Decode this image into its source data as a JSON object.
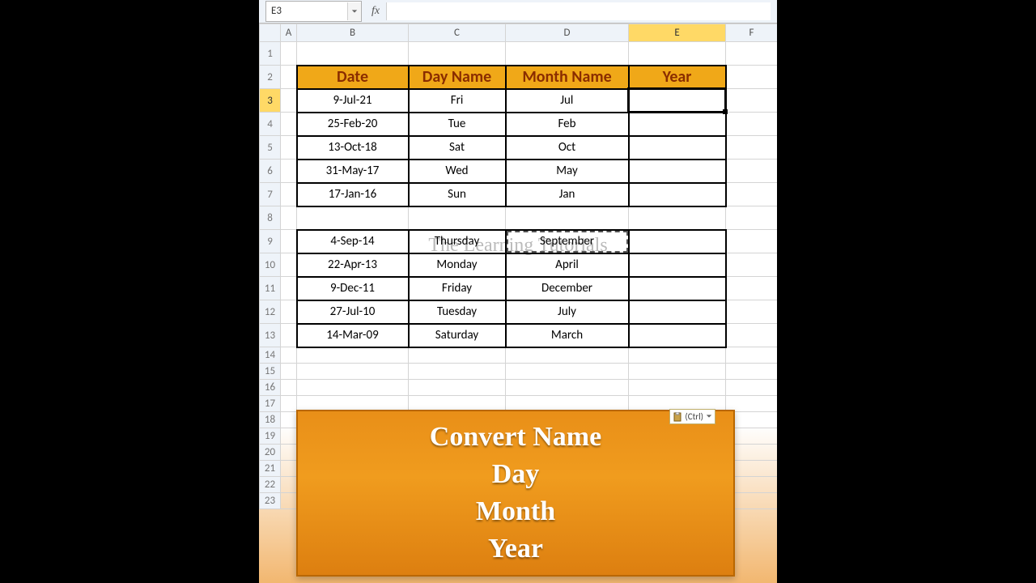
{
  "namebox": {
    "value": "E3"
  },
  "formula_bar": {
    "fx_label": "fx",
    "value": ""
  },
  "columns": [
    "A",
    "B",
    "C",
    "D",
    "E",
    "F"
  ],
  "active": {
    "col": "E",
    "row": 3
  },
  "marquee_cell": "D9",
  "rows_visible": [
    1,
    2,
    3,
    4,
    5,
    6,
    7,
    8,
    9,
    10,
    11,
    12,
    13,
    14,
    15,
    16,
    17,
    18,
    19,
    20,
    21,
    22,
    23
  ],
  "table1": {
    "header_row": 2,
    "headers": [
      "Date",
      "Day Name",
      "Month Name",
      "Year"
    ],
    "rows": [
      {
        "r": 3,
        "date": "9-Jul-21",
        "day": "Fri",
        "month": "Jul",
        "year": ""
      },
      {
        "r": 4,
        "date": "25-Feb-20",
        "day": "Tue",
        "month": "Feb",
        "year": ""
      },
      {
        "r": 5,
        "date": "13-Oct-18",
        "day": "Sat",
        "month": "Oct",
        "year": ""
      },
      {
        "r": 6,
        "date": "31-May-17",
        "day": "Wed",
        "month": "May",
        "year": ""
      },
      {
        "r": 7,
        "date": "17-Jan-16",
        "day": "Sun",
        "month": "Jan",
        "year": ""
      }
    ]
  },
  "table2": {
    "rows": [
      {
        "r": 9,
        "date": "4-Sep-14",
        "day": "Thursday",
        "month": "September",
        "year": ""
      },
      {
        "r": 10,
        "date": "22-Apr-13",
        "day": "Monday",
        "month": "April",
        "year": ""
      },
      {
        "r": 11,
        "date": "9-Dec-11",
        "day": "Friday",
        "month": "December",
        "year": ""
      },
      {
        "r": 12,
        "date": "27-Jul-10",
        "day": "Tuesday",
        "month": "July",
        "year": ""
      },
      {
        "r": 13,
        "date": "14-Mar-09",
        "day": "Saturday",
        "month": "March",
        "year": ""
      }
    ]
  },
  "paste_options": {
    "label": "(Ctrl)"
  },
  "banner": {
    "line1": "Convert Name",
    "line2": "Day",
    "line3": "Month",
    "line4": "Year"
  },
  "watermark": "The Learning Tutorials"
}
